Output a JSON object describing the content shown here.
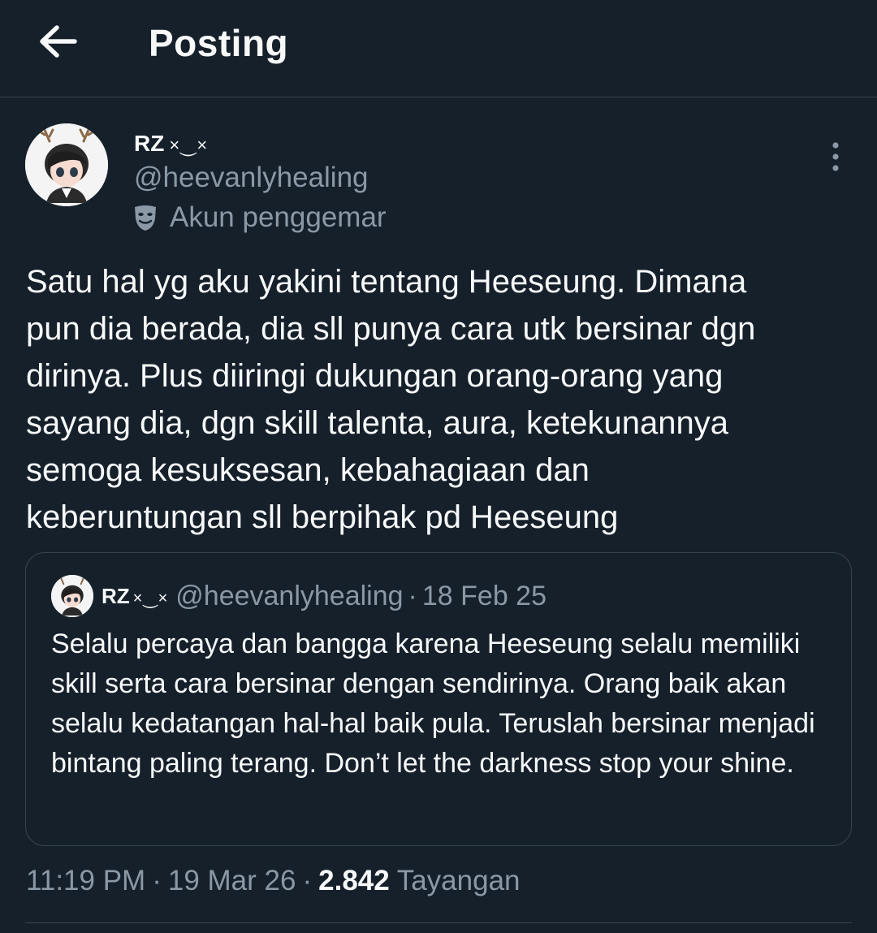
{
  "header": {
    "title": "Posting",
    "back_icon": "arrow-left-icon"
  },
  "author": {
    "display_name": "RZ",
    "name_decoration": "×⏝×",
    "handle": "@heevanlyhealing",
    "label": "Akun penggemar",
    "label_icon": "theater-mask-icon"
  },
  "post": {
    "text": "Satu hal yg aku yakini tentang Heeseung. Dimana\npun dia berada, dia sll punya cara utk bersinar dgn\ndirinya. Plus diiringi dukungan orang-orang yang\nsayang dia, dgn skill talenta, aura, ketekunannya\nsemoga kesuksesan, kebahagiaan dan\nkeberuntungan sll berpihak pd Heeseung",
    "time": "11:19 PM",
    "date": "19 Mar 26",
    "views_count": "2.842",
    "views_label": "Tayangan"
  },
  "quote": {
    "display_name": "RZ",
    "name_decoration": "×⏝×",
    "handle": "@heevanlyhealing",
    "separator": "·",
    "date": "18 Feb 25",
    "text": "Selalu percaya dan bangga karena Heeseung selalu memiliki skill serta cara bersinar dengan sendirinya. Orang baik akan selalu kedatangan hal-hal baik pula. Teruslah bersinar menjadi bintang paling terang. Don’t let the darkness stop your shine."
  },
  "colors": {
    "background": "#15202b",
    "text": "#f7f9f9",
    "secondary_text": "#8b98a5",
    "border": "#38444d"
  }
}
